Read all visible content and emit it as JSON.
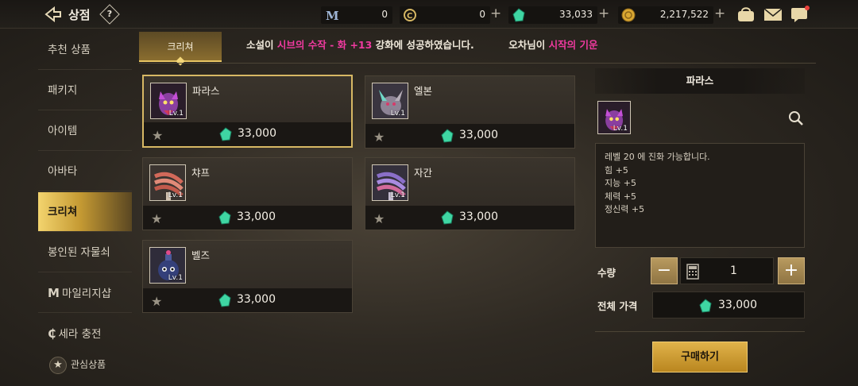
{
  "header": {
    "title": "상점",
    "help_label": "?",
    "currencies": [
      {
        "name": "mileage",
        "value": "0",
        "icon": "mileage-m-icon"
      },
      {
        "name": "sera",
        "value": "0",
        "icon": "sera-coin-icon"
      },
      {
        "name": "gem",
        "value": "33,033",
        "icon": "green-gem-icon"
      },
      {
        "name": "gold",
        "value": "2,217,522",
        "icon": "gold-coin-icon"
      }
    ],
    "plus_label": "+"
  },
  "sidebar": {
    "items": [
      {
        "label": "추천 상품"
      },
      {
        "label": "패키지"
      },
      {
        "label": "아이템"
      },
      {
        "label": "아바타"
      },
      {
        "label": "크리쳐"
      },
      {
        "label": "봉인된 자물쇠"
      },
      {
        "label": "마일리지샵"
      },
      {
        "label": "세라 충전"
      }
    ],
    "favorites_label": "관심상품"
  },
  "tabs": {
    "active": "크리쳐"
  },
  "marquee": {
    "parts": [
      {
        "text": "소설이 ",
        "pink": false
      },
      {
        "text": "시브의 수작 - 화 +13",
        "pink": true
      },
      {
        "text": " 강화에 성공하였습니다.",
        "pink": false
      },
      {
        "text": "          오차님이 ",
        "pink": false
      },
      {
        "text": "시작의 기운",
        "pink": true
      }
    ]
  },
  "products": [
    {
      "name": "파라스",
      "level": "Lv.1",
      "price": "33,000",
      "selected": true
    },
    {
      "name": "엘본",
      "level": "Lv.1",
      "price": "33,000",
      "selected": false
    },
    {
      "name": "챠프",
      "level": "Lv.1",
      "price": "33,000",
      "selected": false
    },
    {
      "name": "자간",
      "level": "Lv.1",
      "price": "33,000",
      "selected": false
    },
    {
      "name": "벨즈",
      "level": "Lv.1",
      "price": "33,000",
      "selected": false
    }
  ],
  "detail": {
    "name": "파라스",
    "level": "Lv.1",
    "description": [
      "레벨 20 에 진화 가능합니다.",
      "힘 +5",
      "지능 +5",
      "체력 +5",
      "정신력 +5"
    ],
    "quantity_label": "수량",
    "quantity_value": "1",
    "minus_label": "−",
    "plus_label": "+",
    "total_label": "전체 가격",
    "total_price": "33,000",
    "buy_label": "구매하기"
  },
  "colors": {
    "accent_gold": "#d7b864",
    "highlight_pink": "#f03aa0",
    "gem_green": "#3fd6a3"
  }
}
